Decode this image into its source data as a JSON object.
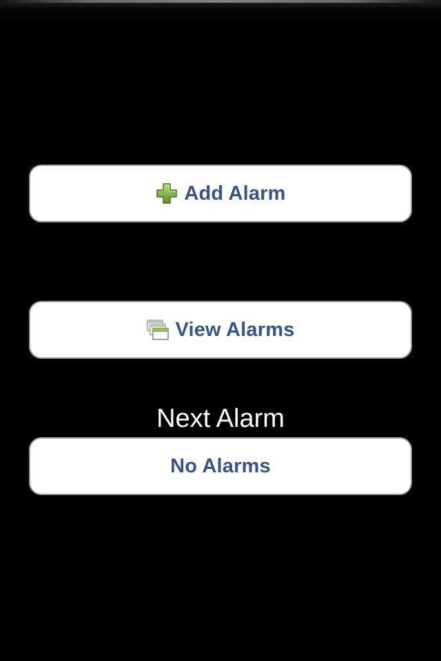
{
  "actions": {
    "add_alarm_label": "Add Alarm",
    "view_alarms_label": "View Alarms"
  },
  "next_alarm": {
    "heading": "Next Alarm",
    "value": "No Alarms"
  },
  "icons": {
    "add": "plus-icon",
    "view": "windows-stack-icon"
  },
  "colors": {
    "background": "#000000",
    "button_fill": "#ffffff",
    "button_text": "#385487",
    "button_border": "#9c9c9c",
    "plus_green": "#7fae3c"
  }
}
